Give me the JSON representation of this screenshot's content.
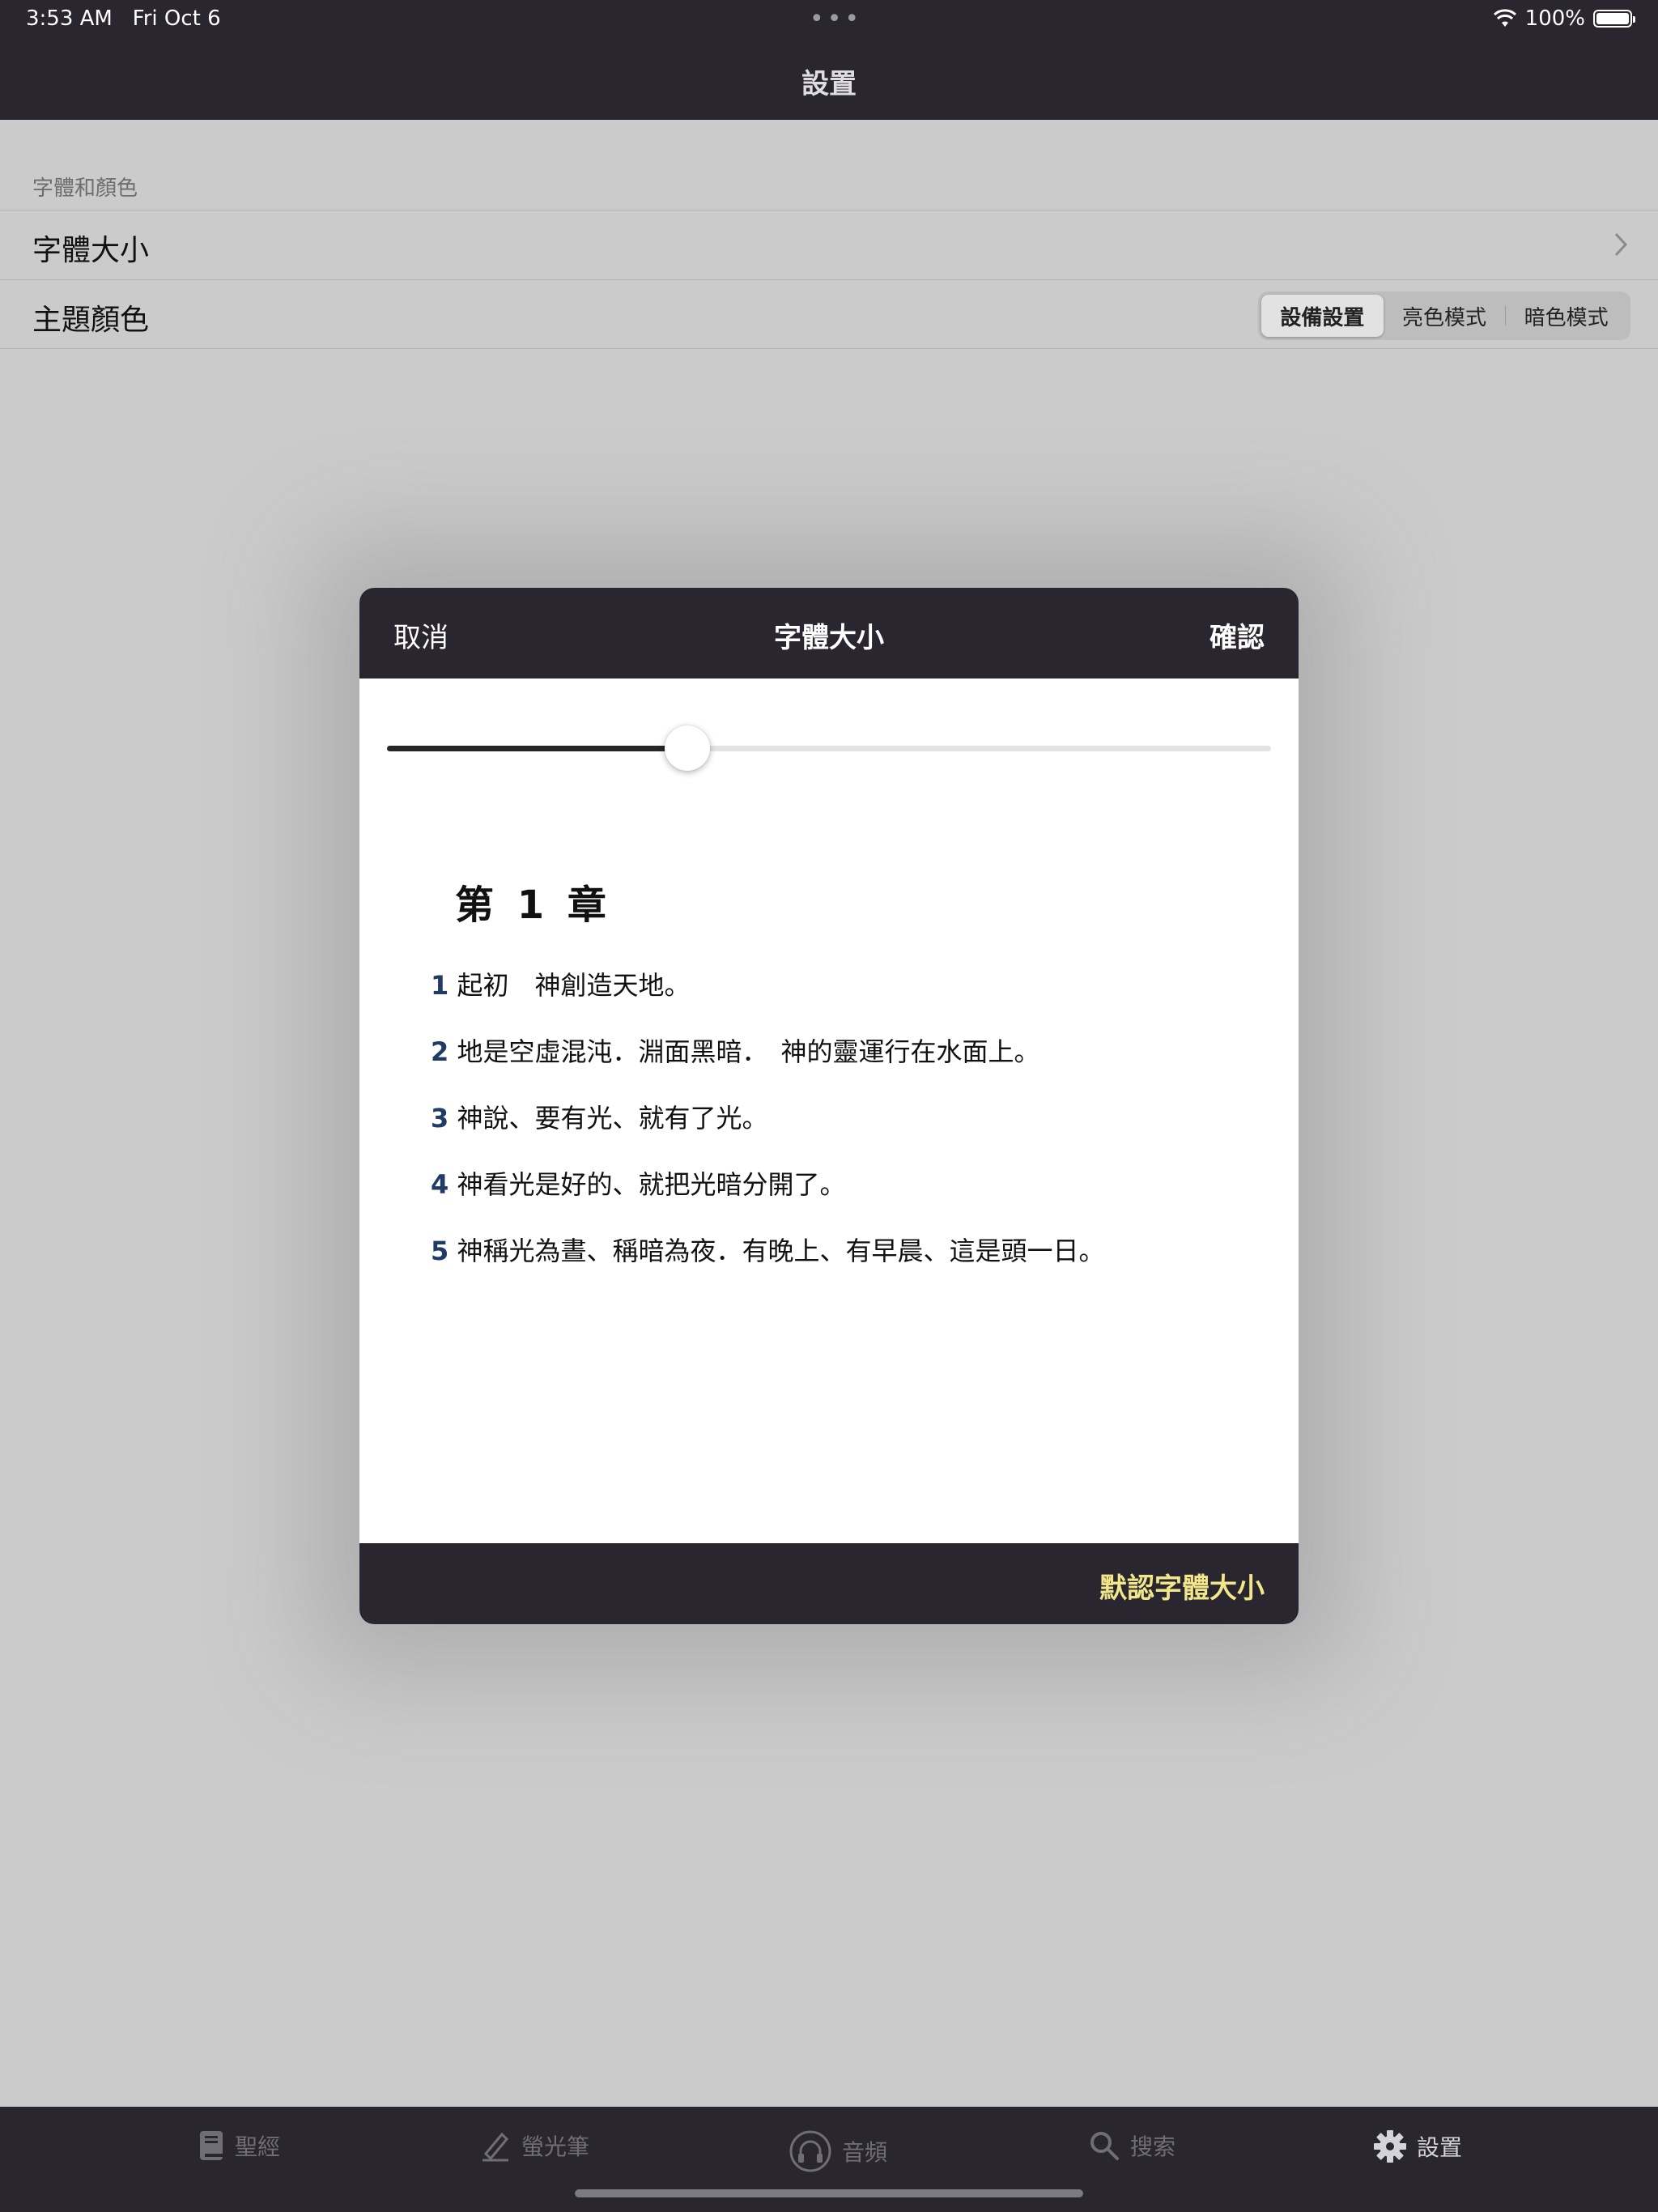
{
  "status_bar": {
    "time": "3:53 AM",
    "date": "Fri Oct 6",
    "dots": "•••",
    "battery": "100%"
  },
  "nav": {
    "title": "設置"
  },
  "settings": {
    "section_header": "字體和顏色",
    "font_size_label": "字體大小",
    "theme_label": "主題顏色",
    "theme_options": [
      "設備設置",
      "亮色模式",
      "暗色模式"
    ],
    "theme_selected": "設備設置"
  },
  "modal": {
    "cancel": "取消",
    "title": "字體大小",
    "confirm": "確認",
    "slider_value": 0.34,
    "chapter": "第 1 章",
    "verses": [
      {
        "num": "1",
        "text": "起初　神創造天地。"
      },
      {
        "num": "2",
        "text": "地是空虛混沌．淵面黑暗．　神的靈運行在水面上。"
      },
      {
        "num": "3",
        "text": "神說、要有光、就有了光。"
      },
      {
        "num": "4",
        "text": "神看光是好的、就把光暗分開了。"
      },
      {
        "num": "5",
        "text": "神稱光為晝、稱暗為夜．有晚上、有早晨、這是頭一日。"
      }
    ],
    "default_button": "默認字體大小"
  },
  "tabs": [
    {
      "label": "聖經",
      "icon": "book-icon"
    },
    {
      "label": "螢光筆",
      "icon": "highlighter-icon"
    },
    {
      "label": "音頻",
      "icon": "headphones-icon"
    },
    {
      "label": "搜索",
      "icon": "search-icon"
    },
    {
      "label": "設置",
      "icon": "gear-icon"
    }
  ],
  "colors": {
    "bar_background": "#29262f",
    "accent_yellow": "#f2e68a",
    "verse_number": "#1f3b66"
  }
}
